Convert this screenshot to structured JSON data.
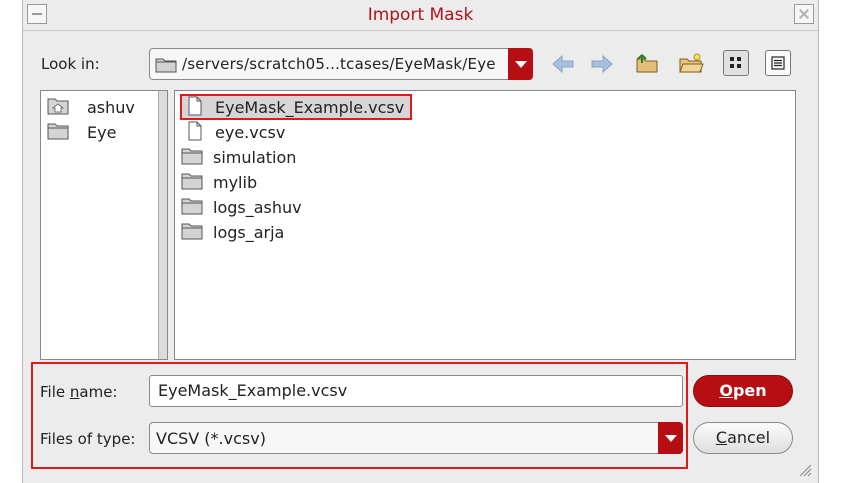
{
  "window": {
    "title": "Import Mask"
  },
  "lookin": {
    "label": "Look in:",
    "path": "/servers/scratch05...tcases/EyeMask/Eye"
  },
  "toolbar": {
    "icons": [
      "back-arrow-icon",
      "forward-arrow-icon",
      "parent-folder-icon",
      "new-folder-icon",
      "list-view-icon",
      "detail-view-icon"
    ]
  },
  "sidebar": {
    "items": [
      {
        "label": "ashuv",
        "icon": "home-folder-icon"
      },
      {
        "label": "Eye",
        "icon": "folder-icon"
      }
    ]
  },
  "files": {
    "selected_index": 0,
    "items": [
      {
        "name": "EyeMask_Example.vcsv",
        "icon": "file-icon"
      },
      {
        "name": "eye.vcsv",
        "icon": "file-icon"
      },
      {
        "name": "simulation",
        "icon": "folder-icon"
      },
      {
        "name": "mylib",
        "icon": "folder-icon"
      },
      {
        "name": "logs_ashuv",
        "icon": "folder-icon"
      },
      {
        "name": "logs_arja",
        "icon": "folder-icon"
      }
    ]
  },
  "form": {
    "file_name_label_pre": "File ",
    "file_name_label_u": "n",
    "file_name_label_post": "ame:",
    "file_name_value": "EyeMask_Example.vcsv",
    "file_type_label": "Files of type:",
    "file_type_value": "VCSV (*.vcsv)"
  },
  "buttons": {
    "open_u": "O",
    "open_rest": "pen",
    "cancel_u": "C",
    "cancel_rest": "ancel"
  },
  "colors": {
    "accent": "#b70e14",
    "highlight_border": "#e01a1a",
    "title": "#b0131b"
  }
}
